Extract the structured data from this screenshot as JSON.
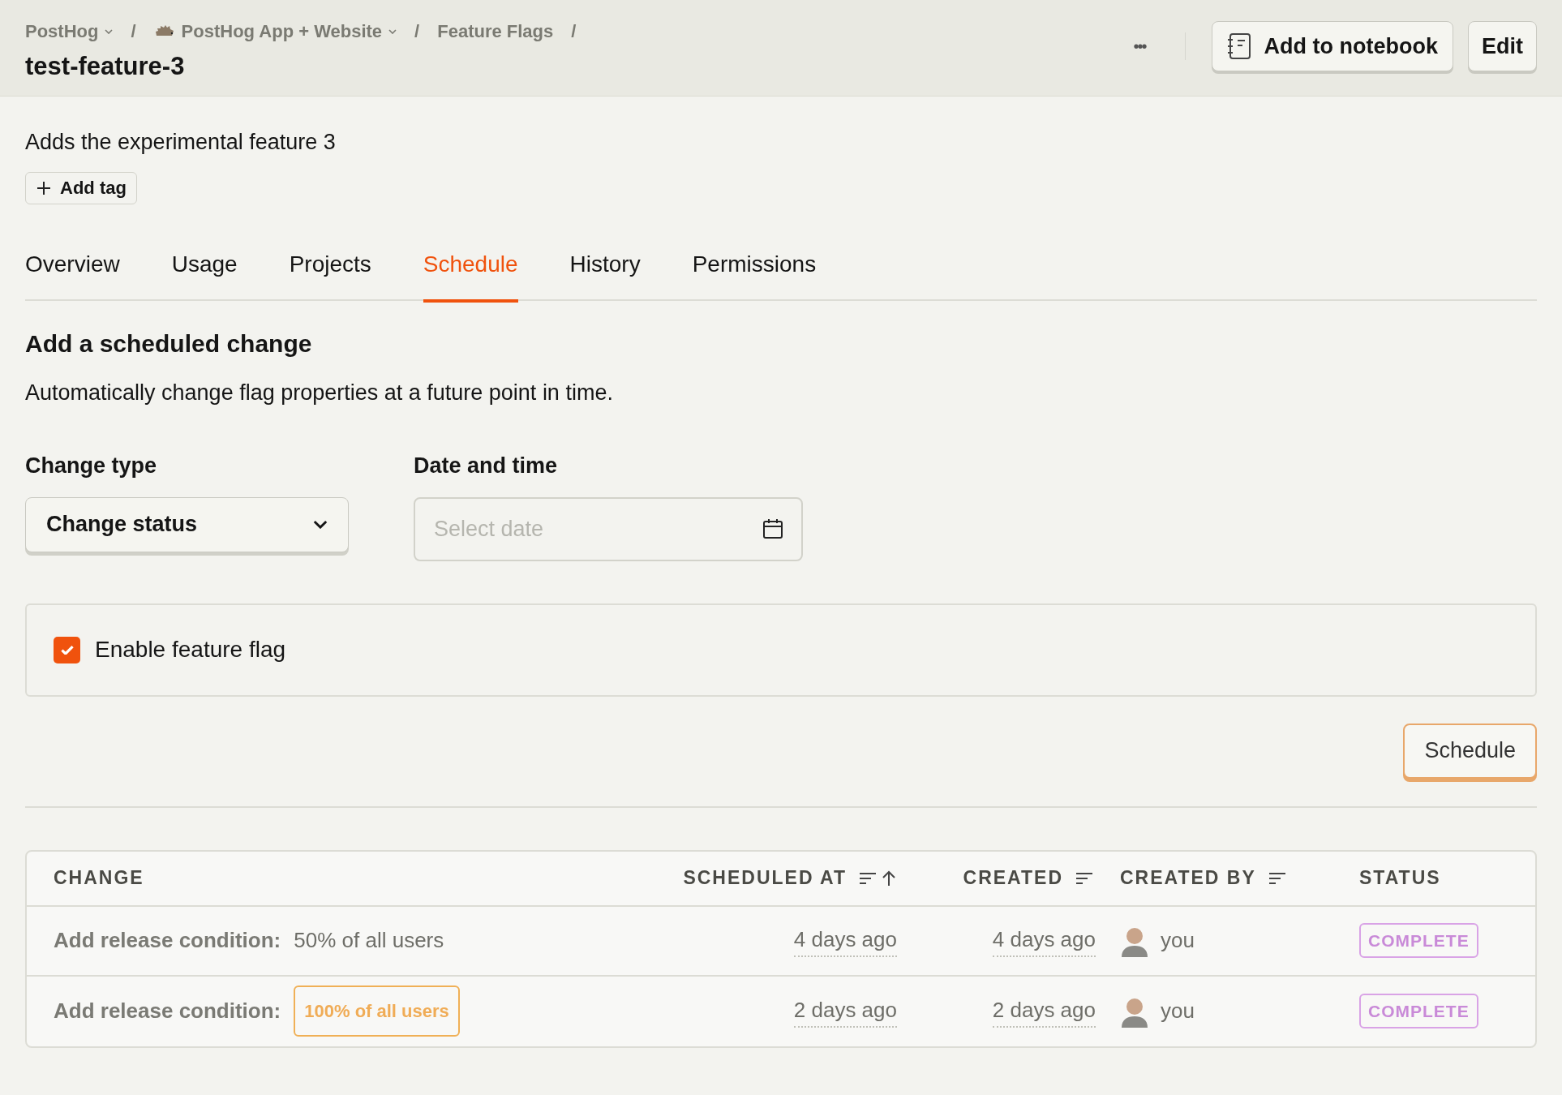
{
  "breadcrumbs": [
    {
      "label": "PostHog",
      "dropdown": true,
      "icon": false,
      "separator": "/"
    },
    {
      "label": "PostHog App + Website",
      "dropdown": true,
      "icon": true,
      "separator": "/"
    },
    {
      "label": "Feature Flags",
      "dropdown": false,
      "icon": false,
      "separator": "/"
    }
  ],
  "title": "test-feature-3",
  "header_actions": {
    "more": "•••",
    "notebook": "Add to notebook",
    "edit": "Edit"
  },
  "description": "Adds the experimental feature 3",
  "add_tag": "Add tag",
  "tabs": [
    {
      "label": "Overview",
      "selected": false
    },
    {
      "label": "Usage",
      "selected": false
    },
    {
      "label": "Projects",
      "selected": false
    },
    {
      "label": "Schedule",
      "selected": true
    },
    {
      "label": "History",
      "selected": false
    },
    {
      "label": "Permissions",
      "selected": false
    }
  ],
  "section": {
    "heading": "Add a scheduled change",
    "subtitle": "Automatically change flag properties at a future point in time."
  },
  "change_type": {
    "label": "Change type",
    "value": "Change status"
  },
  "date_time": {
    "label": "Date and time",
    "placeholder": "Select date"
  },
  "enable_flag": {
    "label": "Enable feature flag",
    "checked": true
  },
  "schedule_button": "Schedule",
  "table": {
    "columns": [
      {
        "label": "CHANGE",
        "sortable": false,
        "sorted": false
      },
      {
        "label": "SCHEDULED AT",
        "sortable": true,
        "sorted": true
      },
      {
        "label": "CREATED",
        "sortable": true,
        "sorted": false
      },
      {
        "label": "CREATED BY",
        "sortable": true,
        "sorted": false
      },
      {
        "label": "STATUS",
        "sortable": false,
        "sorted": false
      }
    ],
    "rows": [
      {
        "change_label": "Add release condition:",
        "change_value": "50% of all users",
        "highlighted": false,
        "scheduled_at": "4 days ago",
        "created": "4 days ago",
        "created_by": "you",
        "status": "COMPLETE"
      },
      {
        "change_label": "Add release condition:",
        "change_value": "100% of all users",
        "highlighted": true,
        "scheduled_at": "2 days ago",
        "created": "2 days ago",
        "created_by": "you",
        "status": "COMPLETE"
      }
    ]
  }
}
